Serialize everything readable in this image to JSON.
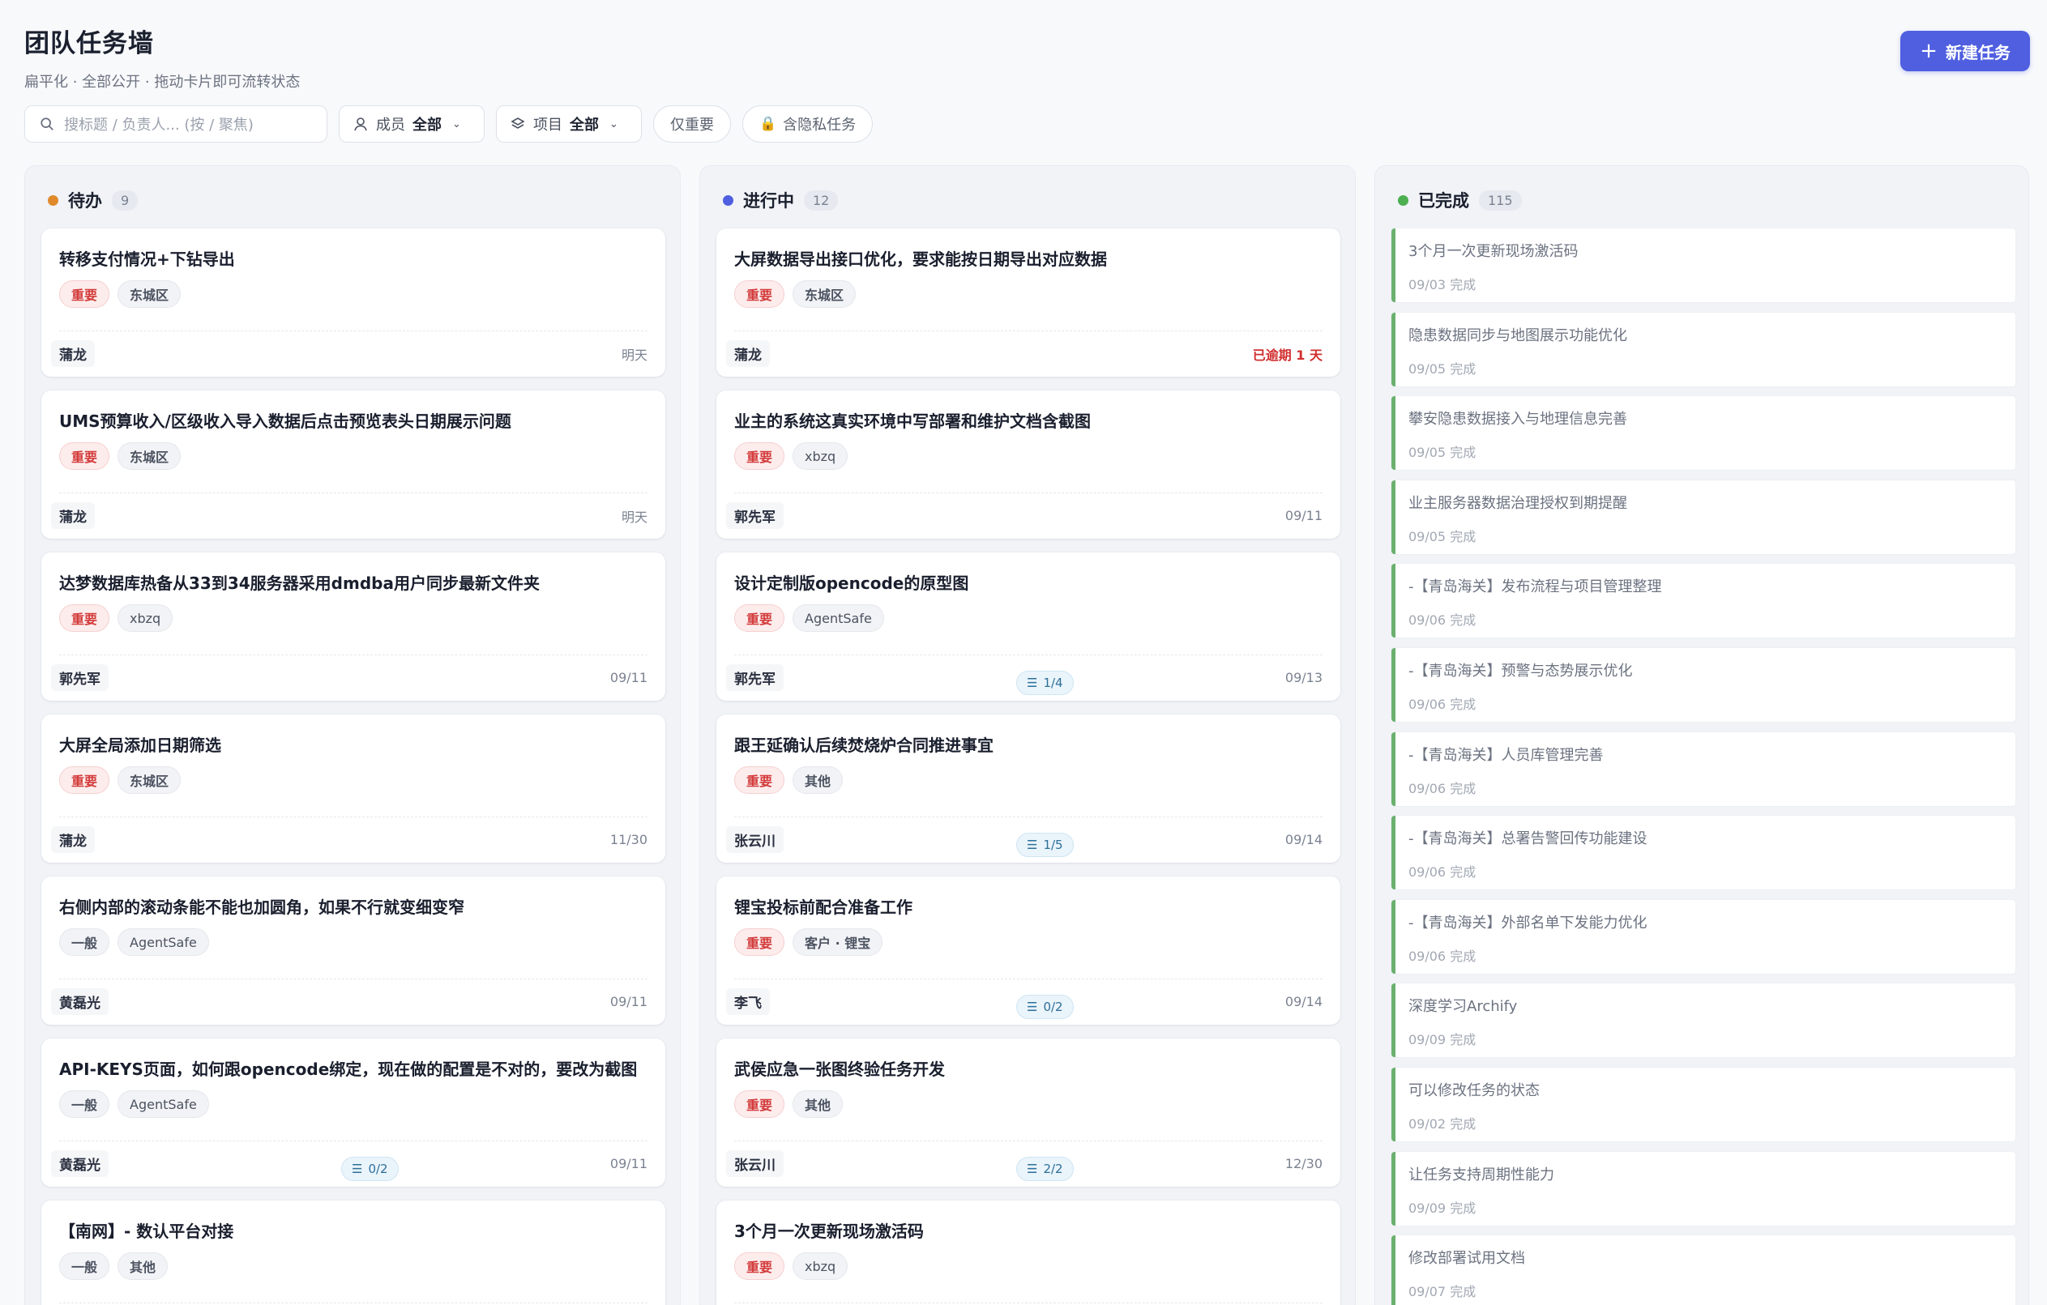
{
  "header": {
    "title": "团队任务墙",
    "subtitle": "扁平化 · 全部公开 · 拖动卡片即可流转状态",
    "new_task_label": "新建任务"
  },
  "filters": {
    "search_placeholder": "搜标题 / 负责人... (按 / 聚焦)",
    "member_label": "成员",
    "member_value": "全部",
    "project_label": "项目",
    "project_value": "全部",
    "important_only": "仅重要",
    "private_label": "含隐私任务"
  },
  "columns": [
    {
      "title": "待办",
      "count": "9",
      "color": "#e08a2c",
      "cards": [
        {
          "title": "转移支付情况+下钻导出",
          "priority": "重要",
          "project": "东城区",
          "assignee": "蒲龙",
          "due": "明天"
        },
        {
          "title": "UMS预算收入/区级收入导入数据后点击预览表头日期展示问题",
          "priority": "重要",
          "project": "东城区",
          "assignee": "蒲龙",
          "due": "明天"
        },
        {
          "title": "达梦数据库热备从33到34服务器采用dmdba用户同步最新文件夹",
          "priority": "重要",
          "project": "xbzq",
          "assignee": "郭先军",
          "due": "09/11"
        },
        {
          "title": "大屏全局添加日期筛选",
          "priority": "重要",
          "project": "东城区",
          "assignee": "蒲龙",
          "due": "11/30"
        },
        {
          "title": "右侧内部的滚动条能不能也加圆角，如果不行就变细变窄",
          "priority": "一般",
          "project": "AgentSafe",
          "assignee": "黄磊光",
          "due": "09/11"
        },
        {
          "title": "API-KEYS页面，如何跟opencode绑定，现在做的配置是不对的，要改为截图",
          "priority": "一般",
          "project": "AgentSafe",
          "assignee": "黄磊光",
          "due": "09/11",
          "subtasks": "0/2"
        },
        {
          "title": "【南网】- 数认平台对接",
          "priority": "一般",
          "project": "其他",
          "assignee": "",
          "due": ""
        }
      ]
    },
    {
      "title": "进行中",
      "count": "12",
      "color": "#4f5fe0",
      "cards": [
        {
          "title": "大屏数据导出接口优化，要求能按日期导出对应数据",
          "priority": "重要",
          "project": "东城区",
          "assignee": "蒲龙",
          "due": "已逾期 1 天",
          "overdue": true
        },
        {
          "title": "业主的系统这真实环境中写部署和维护文档含截图",
          "priority": "重要",
          "project": "xbzq",
          "assignee": "郭先军",
          "due": "09/11"
        },
        {
          "title": "设计定制版opencode的原型图",
          "priority": "重要",
          "project": "AgentSafe",
          "assignee": "郭先军",
          "due": "09/13",
          "subtasks": "1/4"
        },
        {
          "title": "跟王延确认后续焚烧炉合同推进事宜",
          "priority": "重要",
          "project": "其他",
          "assignee": "张云川",
          "due": "09/14",
          "subtasks": "1/5"
        },
        {
          "title": "锂宝投标前配合准备工作",
          "priority": "重要",
          "project": "客户 · 锂宝",
          "assignee": "李飞",
          "due": "09/14",
          "subtasks": "0/2"
        },
        {
          "title": "武侯应急一张图终验任务开发",
          "priority": "重要",
          "project": "其他",
          "assignee": "张云川",
          "due": "12/30",
          "subtasks": "2/2"
        },
        {
          "title": "3个月一次更新现场激活码",
          "priority": "重要",
          "project": "xbzq",
          "assignee": "",
          "due": ""
        }
      ]
    },
    {
      "title": "已完成",
      "count": "115",
      "color": "#4caf50",
      "done": [
        {
          "title": "3个月一次更新现场激活码",
          "date": "09/03 完成"
        },
        {
          "title": "隐患数据同步与地图展示功能优化",
          "date": "09/05 完成"
        },
        {
          "title": "攀安隐患数据接入与地理信息完善",
          "date": "09/05 完成"
        },
        {
          "title": "业主服务器数据治理授权到期提醒",
          "date": "09/05 完成"
        },
        {
          "title": "-【青岛海关】发布流程与项目管理整理",
          "date": "09/06 完成"
        },
        {
          "title": "-【青岛海关】预警与态势展示优化",
          "date": "09/06 完成"
        },
        {
          "title": "-【青岛海关】人员库管理完善",
          "date": "09/06 完成"
        },
        {
          "title": "-【青岛海关】总署告警回传功能建设",
          "date": "09/06 完成"
        },
        {
          "title": "-【青岛海关】外部名单下发能力优化",
          "date": "09/06 完成"
        },
        {
          "title": "深度学习Archify",
          "date": "09/09 完成"
        },
        {
          "title": "可以修改任务的状态",
          "date": "09/02 完成"
        },
        {
          "title": "让任务支持周期性能力",
          "date": "09/09 完成"
        },
        {
          "title": "修改部署试用文档",
          "date": "09/07 完成"
        }
      ]
    }
  ]
}
